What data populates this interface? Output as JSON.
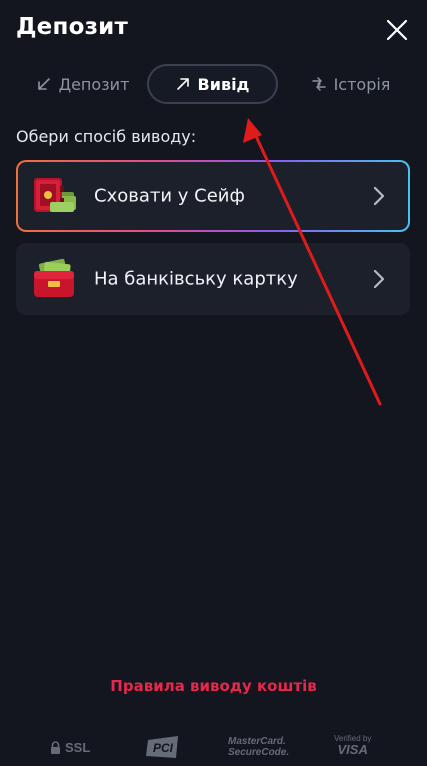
{
  "header": {
    "title": "Депозит",
    "close_icon": "close-icon"
  },
  "tabs": [
    {
      "label": "Депозит",
      "icon": "arrow-down-left-icon",
      "active": false
    },
    {
      "label": "Вивід",
      "icon": "arrow-up-right-icon",
      "active": true
    },
    {
      "label": "Історія",
      "icon": "swap-arrows-icon",
      "active": false
    }
  ],
  "section": {
    "subtitle": "Обери спосіб виводу:"
  },
  "options": [
    {
      "label": "Сховати у Сейф",
      "icon": "safe-money-icon",
      "highlighted": true
    },
    {
      "label": "На банківську картку",
      "icon": "wallet-cash-icon",
      "highlighted": false
    }
  ],
  "rules_link": "Правила виводу коштів",
  "footer": {
    "ssl": "SSL",
    "pci": "PCI",
    "mastercard_line1": "MasterCard.",
    "mastercard_line2": "SecureCode.",
    "visa_line1": "Verified by",
    "visa_line2": "VISA"
  },
  "colors": {
    "background": "#13161f",
    "card": "#1c202b",
    "accent_red": "#e5284b",
    "annotation_arrow": "#e01b1b",
    "muted_text": "#8c93a3"
  }
}
